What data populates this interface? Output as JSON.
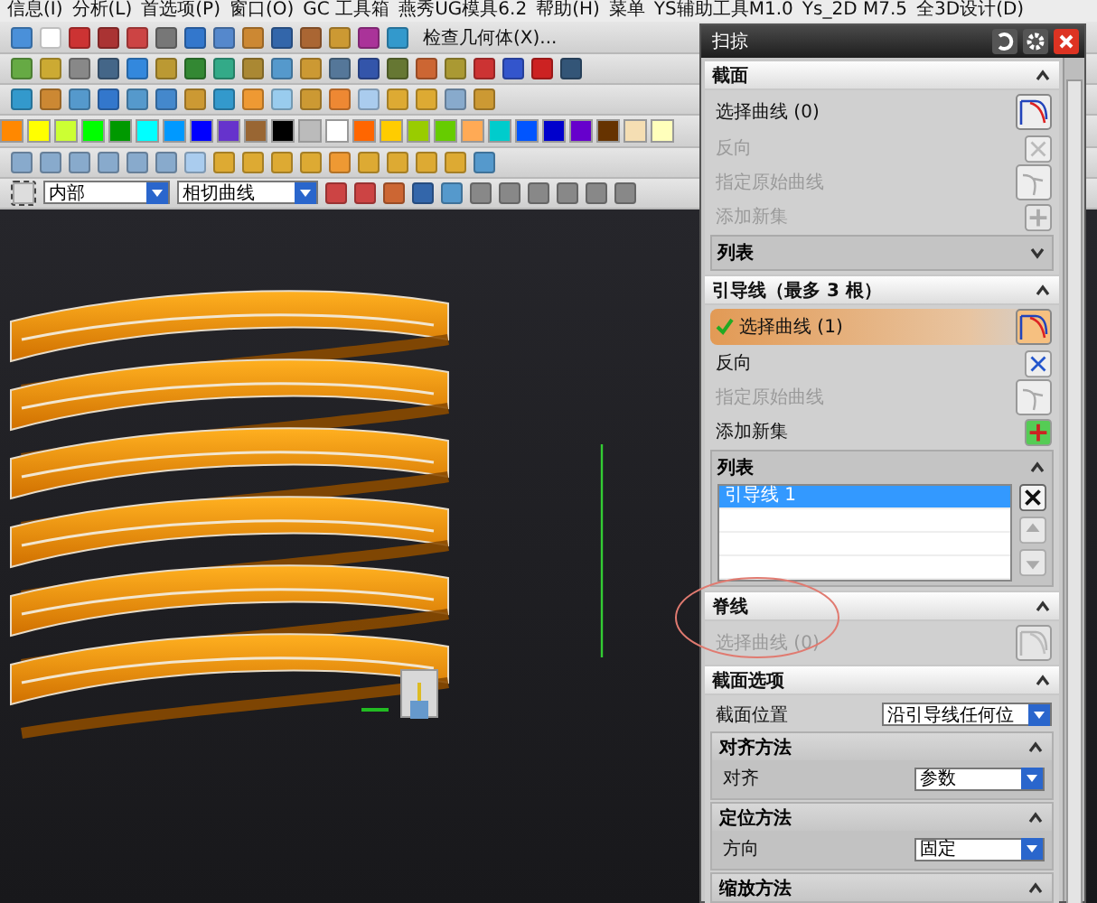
{
  "menu": [
    "信息(I)",
    "分析(L)",
    "首选项(P)",
    "窗口(O)",
    "GC 工具箱",
    "燕秀UG模具6.2",
    "帮助(H)",
    "菜单",
    "YS辅助工具M1.0",
    "Ys_2D M7.5",
    "全3D设计(D)"
  ],
  "toolbar": {
    "check_geometry": "检查几何体(X)..."
  },
  "palette": [
    {
      "color": "#ff8800"
    },
    {
      "color": "#ffff00"
    },
    {
      "color": "#ccff33"
    },
    {
      "color": "#00ff00"
    },
    {
      "color": "#009900"
    },
    {
      "color": "#00ffff"
    },
    {
      "color": "#0099ff"
    },
    {
      "color": "#0000ff"
    },
    {
      "color": "#6633cc"
    },
    {
      "color": "#996633"
    },
    {
      "color": "#000000"
    },
    {
      "color": "#bbbbbb"
    },
    {
      "color": "#ffffff"
    },
    {
      "color": "#ff6600"
    },
    {
      "color": "#ffcc00"
    },
    {
      "color": "#99cc00"
    },
    {
      "color": "#66cc00"
    },
    {
      "color": "#ffaa55"
    },
    {
      "color": "#00cccc"
    },
    {
      "color": "#0055ff"
    },
    {
      "color": "#0000cc"
    },
    {
      "color": "#6600cc"
    },
    {
      "color": "#663300"
    },
    {
      "color": "#f5deb3"
    },
    {
      "color": "#ffffbb"
    }
  ],
  "filters": [
    {
      "value": "内部"
    },
    {
      "value": "相切曲线"
    }
  ],
  "dialog": {
    "title": "扫掠",
    "sections": [
      {
        "title": "截面",
        "expanded": true,
        "rows": [
          {
            "kind": "select",
            "label": "选择曲线 (0)",
            "active": false,
            "disabled": false
          },
          {
            "kind": "action",
            "label": "反向",
            "disabled": true
          },
          {
            "kind": "action",
            "label": "指定原始曲线",
            "disabled": true
          },
          {
            "kind": "action",
            "label": "添加新集",
            "disabled": true
          },
          {
            "kind": "list",
            "title": "列表",
            "expanded": false,
            "items": []
          }
        ]
      },
      {
        "title": "引导线（最多 3 根）",
        "expanded": true,
        "rows": [
          {
            "kind": "select",
            "label": "选择曲线 (1)",
            "active": true,
            "disabled": false
          },
          {
            "kind": "action",
            "label": "反向",
            "disabled": false
          },
          {
            "kind": "action",
            "label": "指定原始曲线",
            "disabled": true
          },
          {
            "kind": "action",
            "label": "添加新集",
            "disabled": false
          },
          {
            "kind": "list",
            "title": "列表",
            "expanded": true,
            "items": [
              {
                "label": "引导线 1",
                "selected": true
              }
            ]
          }
        ]
      },
      {
        "title": "脊线",
        "expanded": true,
        "rows": [
          {
            "kind": "select",
            "label": "选择曲线 (0)",
            "active": false,
            "disabled": true
          }
        ]
      },
      {
        "title": "截面选项",
        "expanded": true,
        "rows": [
          {
            "kind": "dropdown",
            "label": "截面位置",
            "value": "沿引导线任何位"
          },
          {
            "kind": "group",
            "title": "对齐方法",
            "expanded": true,
            "rows": [
              {
                "kind": "dropdown",
                "label": "对齐",
                "value": "参数"
              }
            ]
          },
          {
            "kind": "group",
            "title": "定位方法",
            "expanded": true,
            "rows": [
              {
                "kind": "dropdown",
                "label": "方向",
                "value": "固定"
              }
            ]
          },
          {
            "kind": "group",
            "title": "缩放方法",
            "expanded": true,
            "rows": []
          }
        ]
      }
    ]
  }
}
